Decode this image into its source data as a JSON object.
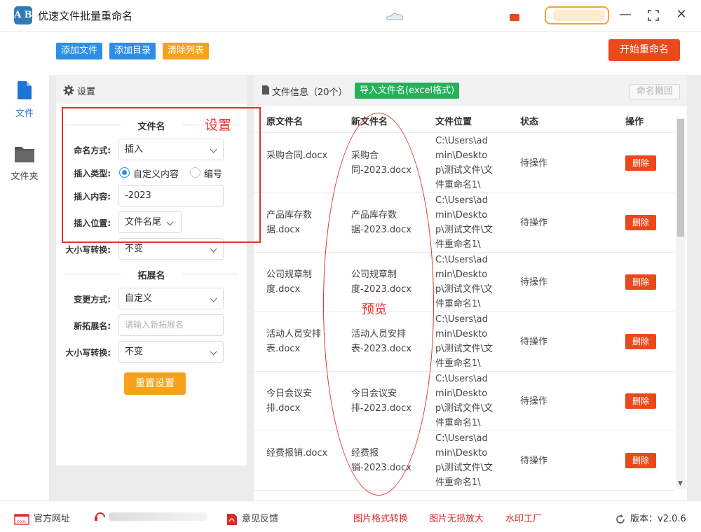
{
  "app": {
    "title": "优速文件批量重命名",
    "logo_text": "A B"
  },
  "nav": {
    "file_label": "文件",
    "folder_label": "文件夹"
  },
  "toolbar": {
    "add_file": "添加文件",
    "add_dir": "添加目录",
    "clear_list": "清除列表",
    "start_rename": "开始重命名"
  },
  "settings": {
    "title": "设置",
    "filename_section": "文件名",
    "naming_mode_label": "命名方式:",
    "naming_mode_value": "插入",
    "insert_type_label": "插入类型:",
    "insert_type_opt1": "自定义内容",
    "insert_type_opt2": "编号",
    "insert_content_label": "插入内容:",
    "insert_content_value": "-2023",
    "insert_pos_label": "插入位置:",
    "insert_pos_value": "文件名尾",
    "case_label": "大小写转换:",
    "case_value": "不变",
    "ext_section": "拓展名",
    "ext_mode_label": "变更方式:",
    "ext_mode_value": "自定义",
    "new_ext_label": "新拓展名:",
    "new_ext_placeholder": "请输入新拓展名",
    "ext_case_label": "大小写转换:",
    "ext_case_value": "不变",
    "reset_button": "重置设置"
  },
  "annotations": {
    "settings": "设置",
    "preview": "预览"
  },
  "files": {
    "title": "文件信息（20个）",
    "import_button": "导入文件名(excel格式)",
    "undo_button": "命名撤回",
    "columns": [
      "原文件名",
      "新文件名",
      "文件位置",
      "状态",
      "操作"
    ],
    "rows": [
      {
        "orig": "采购合同.docx",
        "new": "采购合同-2023.docx",
        "loc": "C:\\Users\\admin\\Desktop\\测试文件\\文件重命名1\\",
        "status": "待操作",
        "action": "删除"
      },
      {
        "orig": "产品库存数据.docx",
        "new": "产品库存数据-2023.docx",
        "loc": "C:\\Users\\admin\\Desktop\\测试文件\\文件重命名1\\",
        "status": "待操作",
        "action": "删除"
      },
      {
        "orig": "公司规章制度.docx",
        "new": "公司规章制度-2023.docx",
        "loc": "C:\\Users\\admin\\Desktop\\测试文件\\文件重命名1\\",
        "status": "待操作",
        "action": "删除"
      },
      {
        "orig": "活动人员安排表.docx",
        "new": "活动人员安排表-2023.docx",
        "loc": "C:\\Users\\admin\\Desktop\\测试文件\\文件重命名1\\",
        "status": "待操作",
        "action": "删除"
      },
      {
        "orig": "今日会议安排.docx",
        "new": "今日会议安排-2023.docx",
        "loc": "C:\\Users\\admin\\Desktop\\测试文件\\文件重命名1\\",
        "status": "待操作",
        "action": "删除"
      },
      {
        "orig": "经费报销.docx",
        "new": "经费报销-2023.docx",
        "loc": "C:\\Users\\admin\\Desktop\\测试文件\\文件重命名1\\",
        "status": "待操作",
        "action": "删除"
      }
    ]
  },
  "statusbar": {
    "website": "官方网址",
    "feedback": "意见反馈",
    "link1": "图片格式转换",
    "link2": "图片无损放大",
    "link3": "水印工厂",
    "version": "版本：v2.0.6"
  }
}
